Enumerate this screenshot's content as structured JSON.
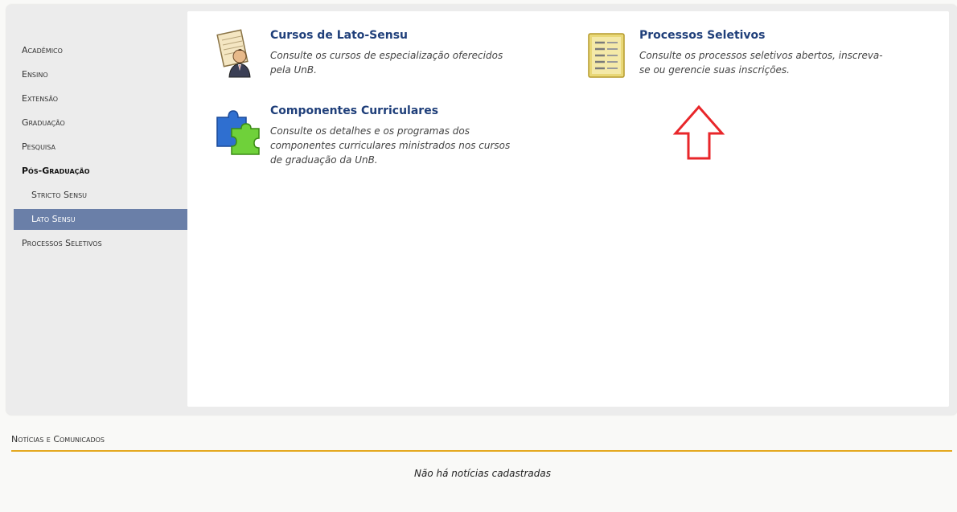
{
  "sidebar": {
    "items": [
      {
        "label": "Acadêmico"
      },
      {
        "label": "Ensino"
      },
      {
        "label": "Extensão"
      },
      {
        "label": "Graduação"
      },
      {
        "label": "Pesquisa"
      },
      {
        "label": "Pós-Graduação"
      },
      {
        "label": "Stricto Sensu"
      },
      {
        "label": "Lato Sensu"
      },
      {
        "label": "Processos Seletivos"
      }
    ],
    "active_label": "Lato Sensu",
    "active_color": "#6a7fa8"
  },
  "cards": [
    {
      "title": "Cursos de Lato-Sensu",
      "desc_line1": "Consulte os cursos de especialização oferecidos",
      "desc_line2": "pela UnB.",
      "icon": "document-person-icon"
    },
    {
      "title": "Processos Seletivos",
      "desc_line1": "Consulte os processos seletivos abertos, inscreva-",
      "desc_line2": "se ou gerencie suas inscrições.",
      "icon": "form-list-icon"
    },
    {
      "title": "Componentes Curriculares",
      "desc_line1": "Consulte os detalhes e os programas dos",
      "desc_line2": "componentes curriculares ministrados nos cursos",
      "desc_line3": "de graduação da UnB.",
      "icon": "puzzle-icon"
    }
  ],
  "news": {
    "header": "Notícias e Comunicados",
    "empty_text": "Não há notícias cadastradas",
    "rule_color": "#e4a81f"
  },
  "annotation": {
    "icon": "up-arrow-icon",
    "color": "#e8262a"
  }
}
